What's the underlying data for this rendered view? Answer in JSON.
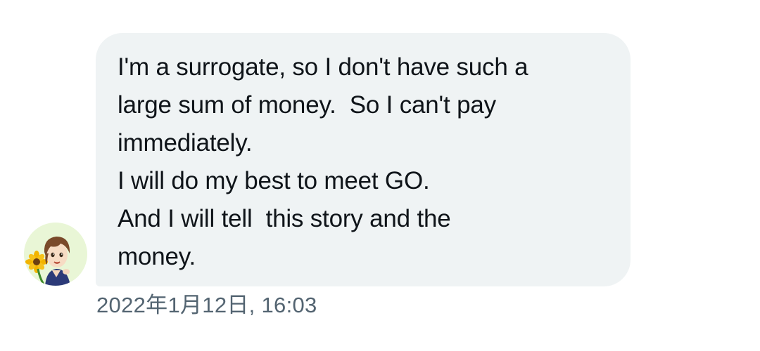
{
  "message": {
    "lines": [
      "I'm a surrogate, so I don't have such a",
      "large sum of money.  So I can't pay",
      "immediately.",
      "I will do my best to meet GO.",
      "And I will tell  this story and the",
      "money."
    ],
    "timestamp": "2022年1月12日, 16:03"
  },
  "avatar": {
    "icon": "user-avatar-illustration"
  },
  "colors": {
    "bubble_background": "#eff3f4",
    "text": "#0f1419",
    "timestamp": "#536471",
    "page_background": "#ffffff"
  }
}
